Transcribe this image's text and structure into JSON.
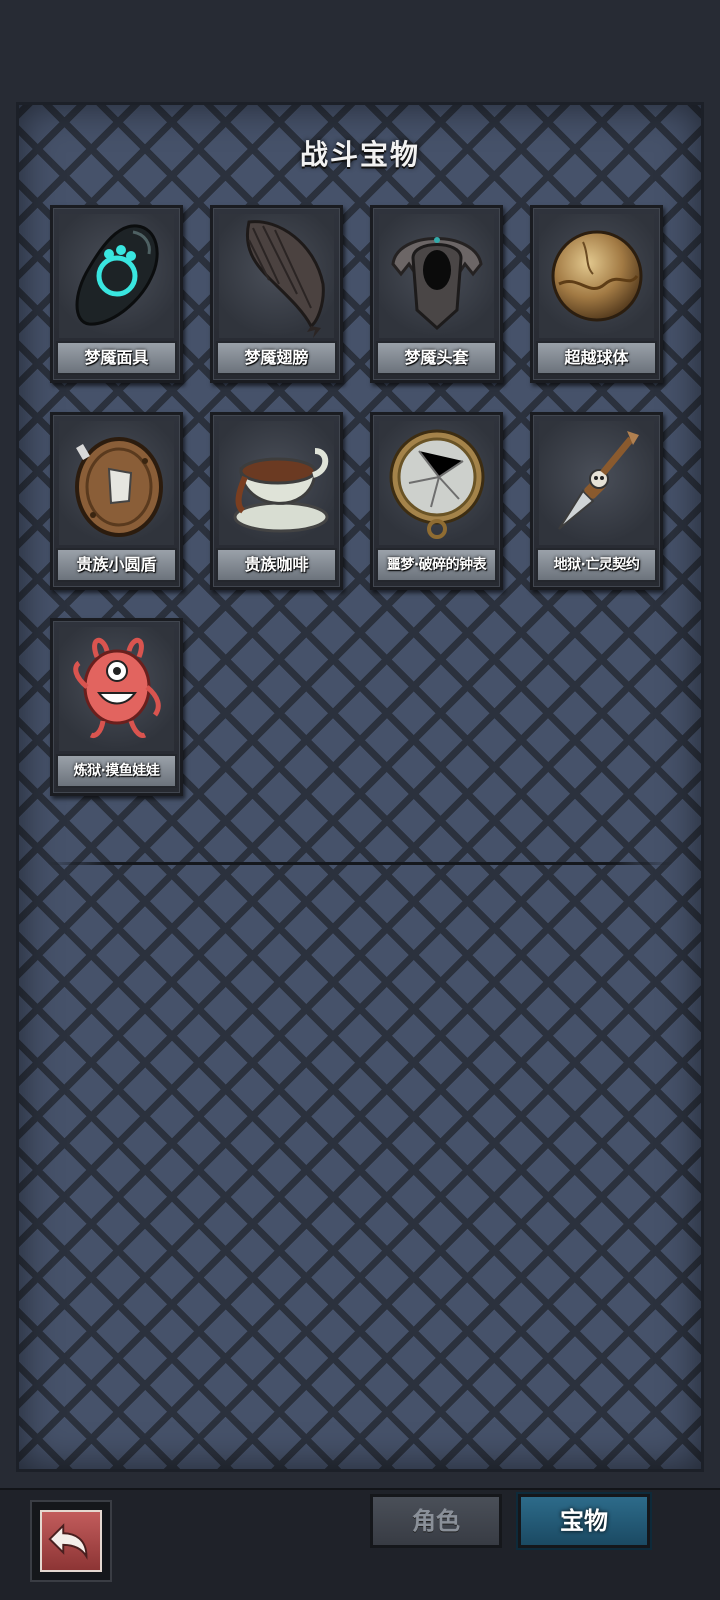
{
  "panel": {
    "title": "战斗宝物"
  },
  "items": [
    {
      "name": "梦魇面具",
      "icon": "nightmare-mask-icon"
    },
    {
      "name": "梦魇翅膀",
      "icon": "nightmare-wing-icon"
    },
    {
      "name": "梦魇头套",
      "icon": "nightmare-helmet-icon"
    },
    {
      "name": "超越球体",
      "icon": "transcendent-orb-icon"
    },
    {
      "name": "贵族小圆盾",
      "icon": "noble-buckler-icon"
    },
    {
      "name": "贵族咖啡",
      "icon": "noble-coffee-icon"
    },
    {
      "name": "噩梦·破碎的钟表",
      "icon": "broken-pocket-watch-icon"
    },
    {
      "name": "地狱·亡灵契约",
      "icon": "skull-dagger-icon"
    },
    {
      "name": "炼狱·摸鱼娃娃",
      "icon": "red-doll-icon"
    }
  ],
  "tabs": {
    "role": "角色",
    "treasure": "宝物",
    "active": "treasure"
  },
  "back_button": {
    "icon": "back-arrow-icon"
  },
  "colors": {
    "active_tab": "#2d6b8a",
    "back_button": "#c25c5c"
  }
}
